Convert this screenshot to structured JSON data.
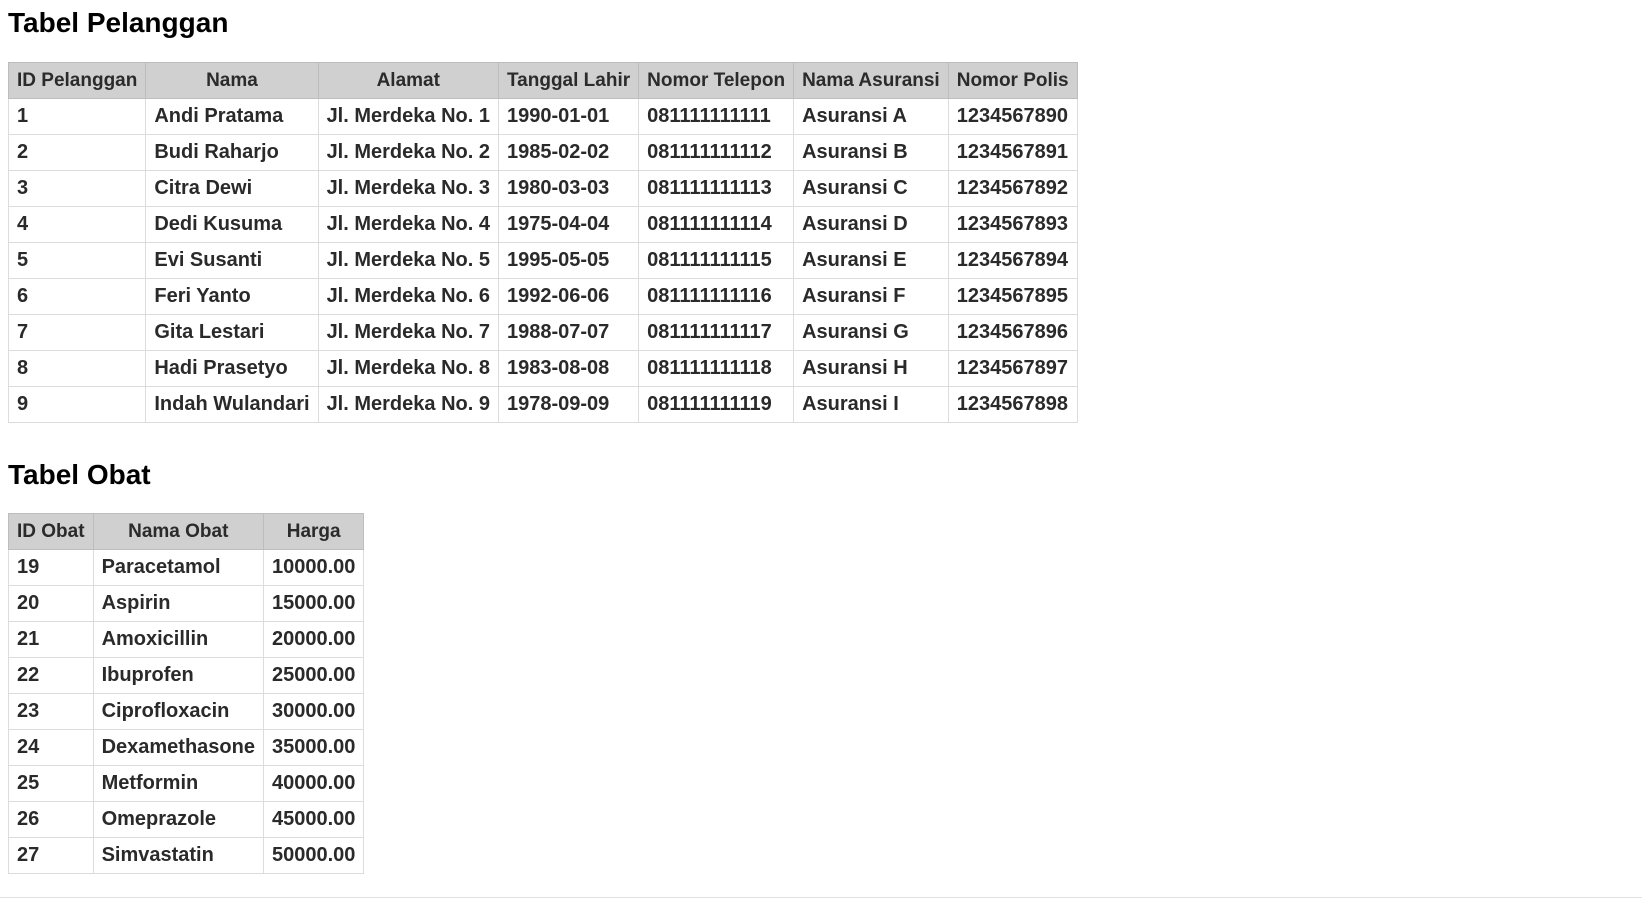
{
  "pelanggan": {
    "title": "Tabel Pelanggan",
    "headers": [
      "ID Pelanggan",
      "Nama",
      "Alamat",
      "Tanggal Lahir",
      "Nomor Telepon",
      "Nama Asuransi",
      "Nomor Polis"
    ],
    "rows": [
      [
        "1",
        "Andi Pratama",
        "Jl. Merdeka No. 1",
        "1990-01-01",
        "081111111111",
        "Asuransi A",
        "1234567890"
      ],
      [
        "2",
        "Budi Raharjo",
        "Jl. Merdeka No. 2",
        "1985-02-02",
        "081111111112",
        "Asuransi B",
        "1234567891"
      ],
      [
        "3",
        "Citra Dewi",
        "Jl. Merdeka No. 3",
        "1980-03-03",
        "081111111113",
        "Asuransi C",
        "1234567892"
      ],
      [
        "4",
        "Dedi Kusuma",
        "Jl. Merdeka No. 4",
        "1975-04-04",
        "081111111114",
        "Asuransi D",
        "1234567893"
      ],
      [
        "5",
        "Evi Susanti",
        "Jl. Merdeka No. 5",
        "1995-05-05",
        "081111111115",
        "Asuransi E",
        "1234567894"
      ],
      [
        "6",
        "Feri Yanto",
        "Jl. Merdeka No. 6",
        "1992-06-06",
        "081111111116",
        "Asuransi F",
        "1234567895"
      ],
      [
        "7",
        "Gita Lestari",
        "Jl. Merdeka No. 7",
        "1988-07-07",
        "081111111117",
        "Asuransi G",
        "1234567896"
      ],
      [
        "8",
        "Hadi Prasetyo",
        "Jl. Merdeka No. 8",
        "1983-08-08",
        "081111111118",
        "Asuransi H",
        "1234567897"
      ],
      [
        "9",
        "Indah Wulandari",
        "Jl. Merdeka No. 9",
        "1978-09-09",
        "081111111119",
        "Asuransi I",
        "1234567898"
      ]
    ]
  },
  "obat": {
    "title": "Tabel Obat",
    "headers": [
      "ID Obat",
      "Nama Obat",
      "Harga"
    ],
    "rows": [
      [
        "19",
        "Paracetamol",
        "10000.00"
      ],
      [
        "20",
        "Aspirin",
        "15000.00"
      ],
      [
        "21",
        "Amoxicillin",
        "20000.00"
      ],
      [
        "22",
        "Ibuprofen",
        "25000.00"
      ],
      [
        "23",
        "Ciprofloxacin",
        "30000.00"
      ],
      [
        "24",
        "Dexamethasone",
        "35000.00"
      ],
      [
        "25",
        "Metformin",
        "40000.00"
      ],
      [
        "26",
        "Omeprazole",
        "45000.00"
      ],
      [
        "27",
        "Simvastatin",
        "50000.00"
      ]
    ]
  }
}
